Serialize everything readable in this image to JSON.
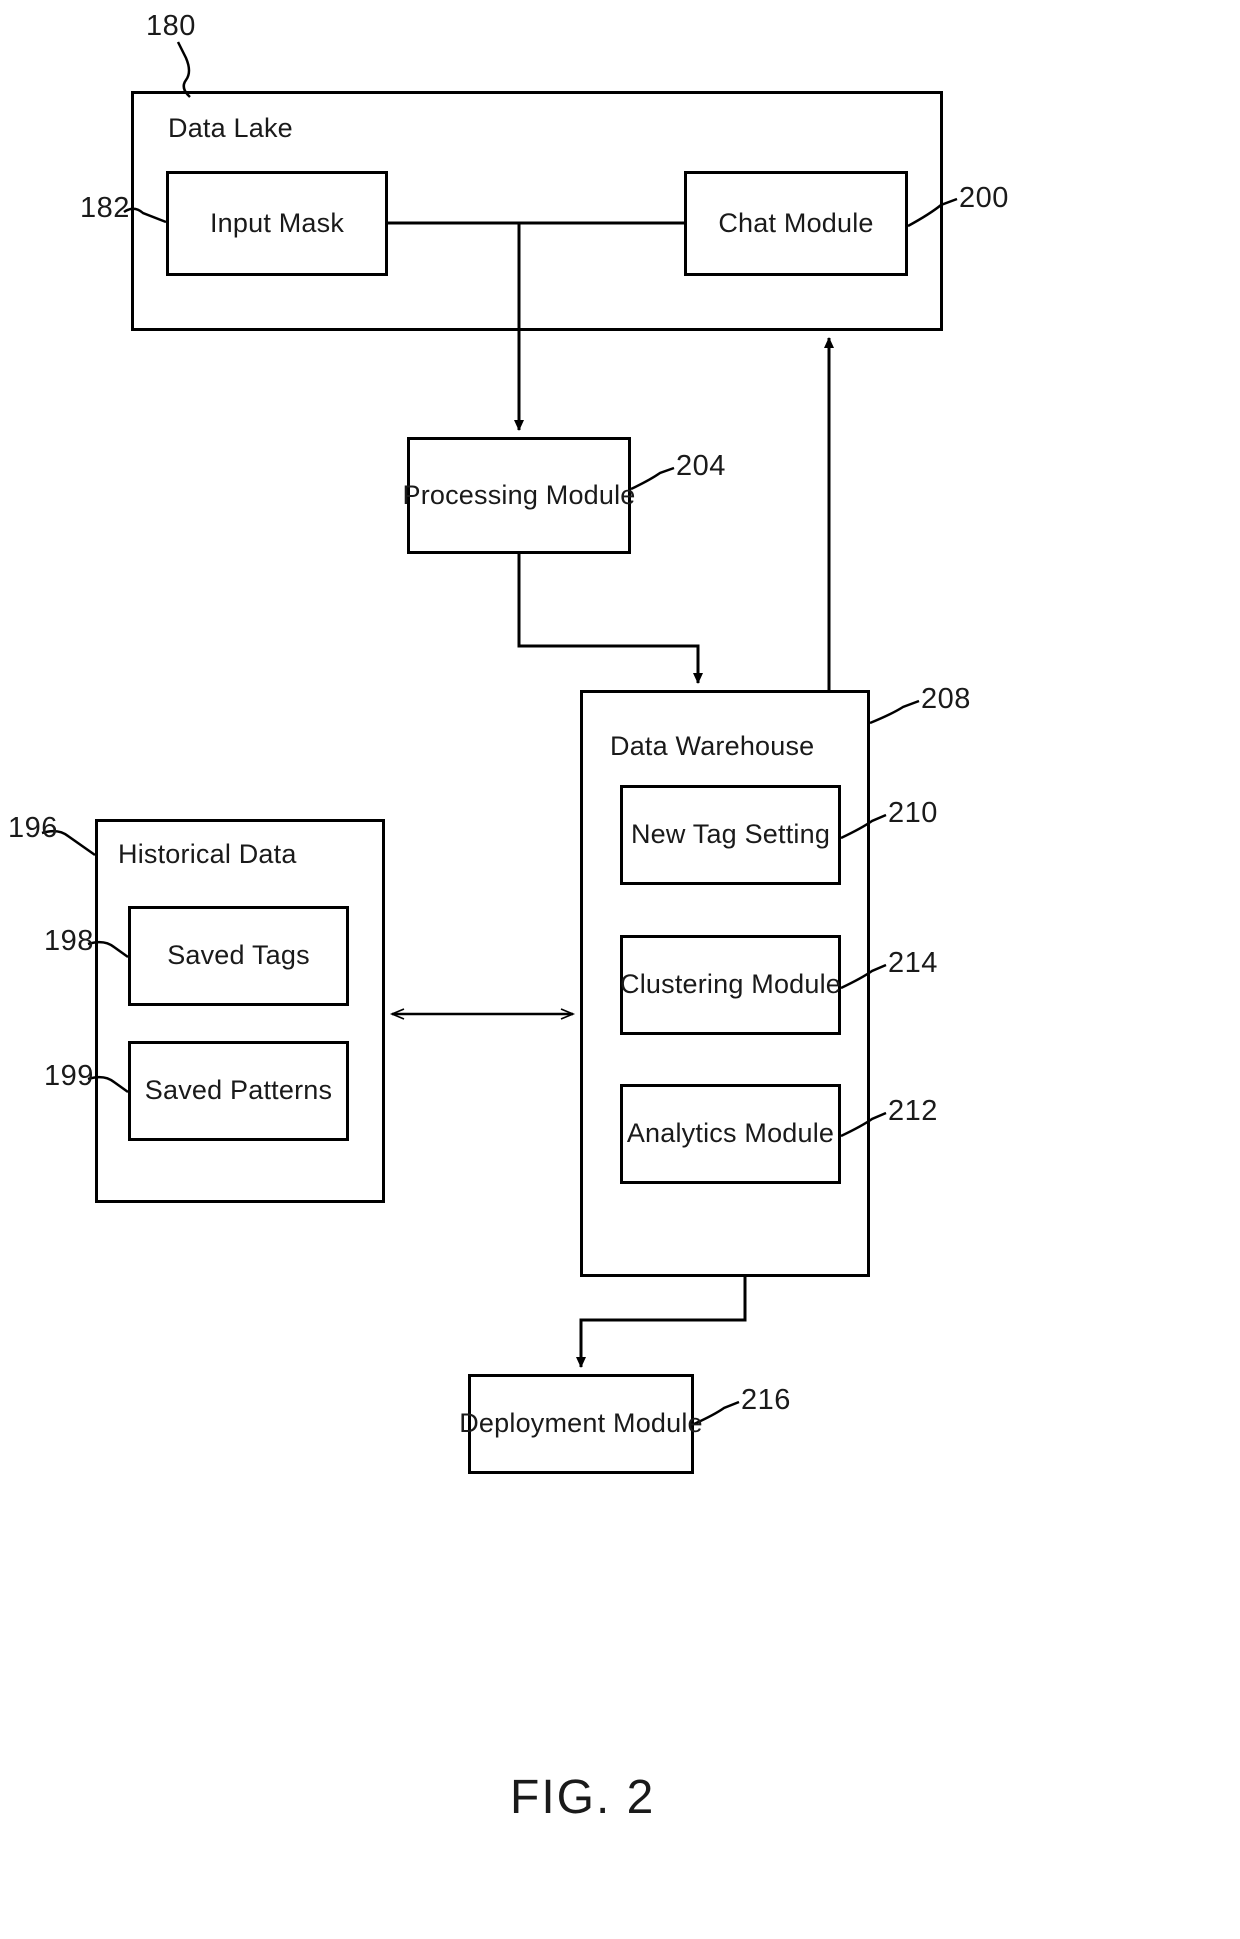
{
  "figure": {
    "caption": "FIG. 2"
  },
  "nodes": {
    "data_lake": {
      "label": "Data Lake",
      "ref": "180"
    },
    "input_mask": {
      "label": "Input Mask",
      "ref": "182"
    },
    "chat_module": {
      "label": "Chat Module",
      "ref": "200"
    },
    "processing_module": {
      "label": "Processing Module",
      "ref": "204"
    },
    "data_warehouse": {
      "label": "Data Warehouse",
      "ref": "208"
    },
    "new_tag_setting": {
      "label": "New Tag Setting",
      "ref": "210"
    },
    "clustering_module": {
      "label": "Clustering Module",
      "ref": "214"
    },
    "analytics_module": {
      "label": "Analytics Module",
      "ref": "212"
    },
    "historical_data": {
      "label": "Historical Data",
      "ref": "196"
    },
    "saved_tags": {
      "label": "Saved Tags",
      "ref": "198"
    },
    "saved_patterns": {
      "label": "Saved Patterns",
      "ref": "199"
    },
    "deployment_module": {
      "label": "Deployment Module",
      "ref": "216"
    }
  },
  "connections": [
    {
      "name": "input-mask-to-chat-module",
      "from": "input_mask",
      "to": "chat_module",
      "arrow": "none"
    },
    {
      "name": "input-mask-to-processing-module",
      "from": "input_mask",
      "to": "processing_module",
      "arrow": "single"
    },
    {
      "name": "processing-module-to-data-warehouse",
      "from": "processing_module",
      "to": "data_warehouse",
      "arrow": "single"
    },
    {
      "name": "data-warehouse-to-chat-module",
      "from": "data_warehouse",
      "to": "chat_module",
      "arrow": "single"
    },
    {
      "name": "historical-data-to-data-warehouse",
      "from": "historical_data",
      "to": "data_warehouse",
      "arrow": "double"
    },
    {
      "name": "data-warehouse-to-deployment-module",
      "from": "data_warehouse",
      "to": "deployment_module",
      "arrow": "single"
    }
  ],
  "colors": {
    "stroke": "#000000",
    "text": "#1a1a1a",
    "background": "#ffffff"
  }
}
